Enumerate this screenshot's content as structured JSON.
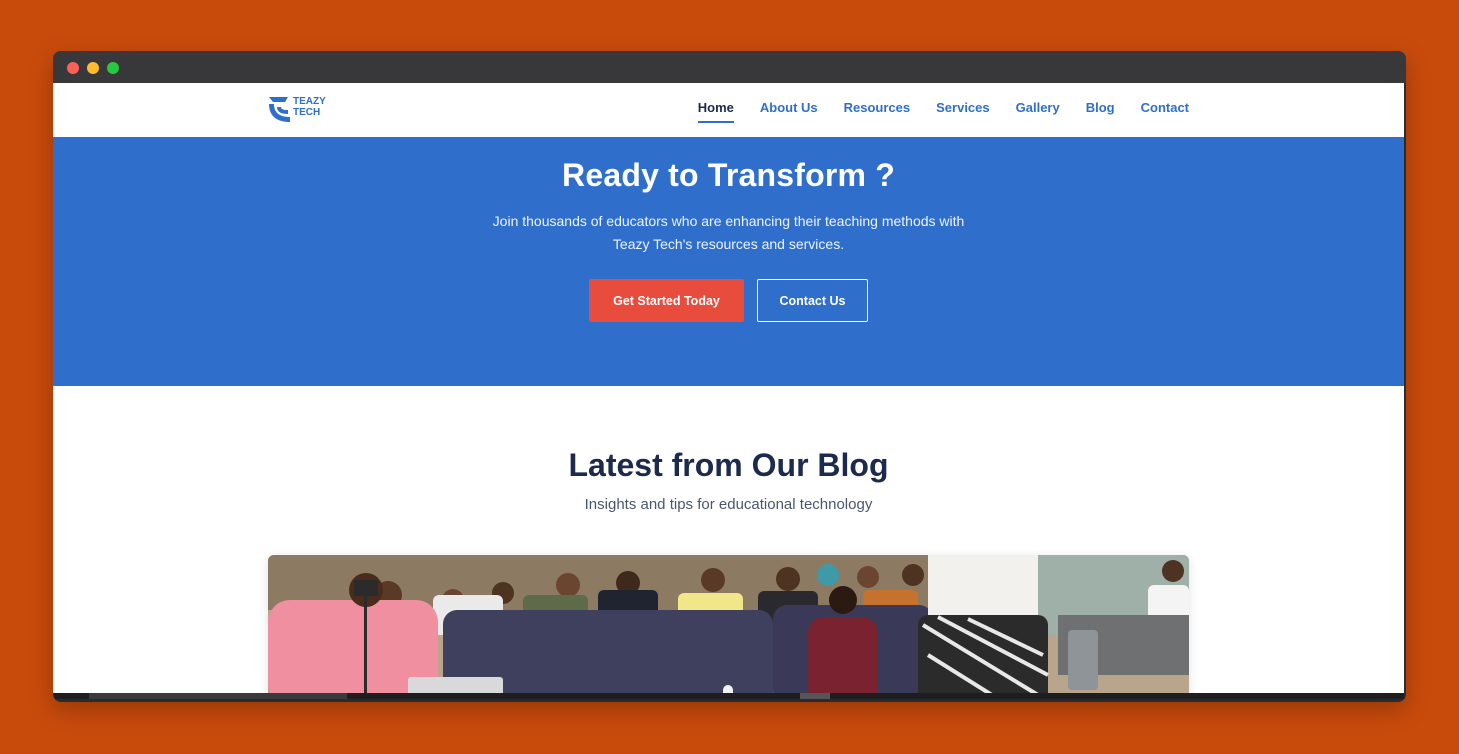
{
  "brand": {
    "name_line1": "TEAZY",
    "name_line2": "TECH"
  },
  "nav": {
    "items": [
      {
        "label": "Home",
        "active": true
      },
      {
        "label": "About Us"
      },
      {
        "label": "Resources"
      },
      {
        "label": "Services"
      },
      {
        "label": "Gallery"
      },
      {
        "label": "Blog"
      },
      {
        "label": "Contact"
      }
    ]
  },
  "hero": {
    "title": "Ready to Transform ?",
    "subtitle_line1": "Join thousands of educators who are enhancing their teaching methods with",
    "subtitle_line2": "Teazy Tech's resources and services.",
    "primary_button": "Get Started Today",
    "secondary_button": "Contact Us"
  },
  "blog": {
    "title": "Latest from Our Blog",
    "subtitle": "Insights and tips for educational technology"
  },
  "colors": {
    "brand_blue": "#2f6fcb",
    "accent_red": "#e84c3d",
    "heading_navy": "#1c2a4d",
    "page_background": "#c94b0c"
  }
}
